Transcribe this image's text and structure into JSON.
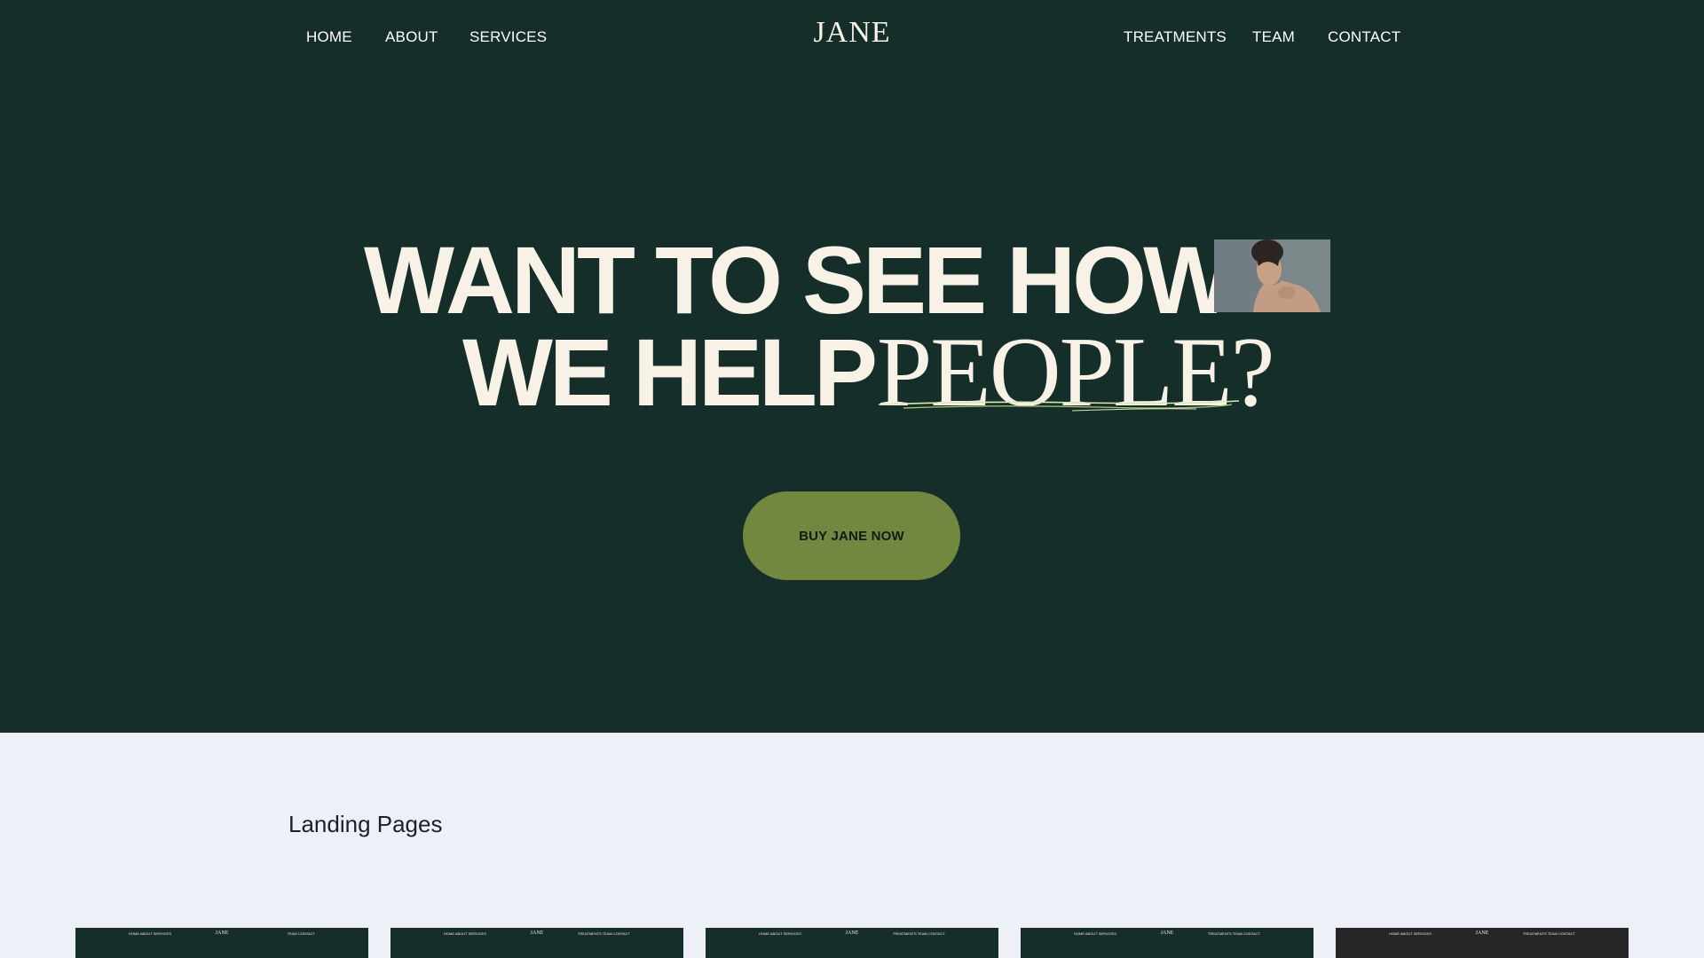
{
  "nav": {
    "left": [
      "HOME",
      "ABOUT",
      "SERVICES"
    ],
    "logo": "JANE",
    "right": [
      "TREATMENTS",
      "TEAM",
      "CONTACT"
    ]
  },
  "hero": {
    "line1": "WANT TO SEE HOW",
    "line2_sans": "WE HELP",
    "line2_serif": "PEOPLE?",
    "cta_label": "BUY JANE NOW"
  },
  "section": {
    "title": "Landing Pages"
  },
  "thumbnails": [
    {
      "left": "HOME  ABOUT  SERVICES",
      "logo": "JANE",
      "right": "TEAM  CONTACT"
    },
    {
      "left": "HOME  ABOUT  SERVICES",
      "logo": "JANE",
      "right": "TREATMENTS  TEAM  CONTACT"
    },
    {
      "left": "HOME  ABOUT  SERVICES",
      "logo": "JANE",
      "right": "TREATMENTS  TEAM  CONTACT"
    },
    {
      "left": "HOME  ABOUT  SERVICES",
      "logo": "JANE",
      "right": "TREATMENTS  TEAM  CONTACT"
    },
    {
      "left": "HOME  ABOUT  SERVICES",
      "logo": "JANE",
      "right": "TREATMENTS  TEAM  CONTACT"
    }
  ],
  "colors": {
    "hero_bg": "#162e2a",
    "cream_text": "#f7f1e6",
    "cta_bg": "#728740",
    "page_bg": "#eef0f7",
    "underline_accent": "#b9d77a"
  },
  "icons": {
    "hero_photo": "woman-portrait-image"
  }
}
